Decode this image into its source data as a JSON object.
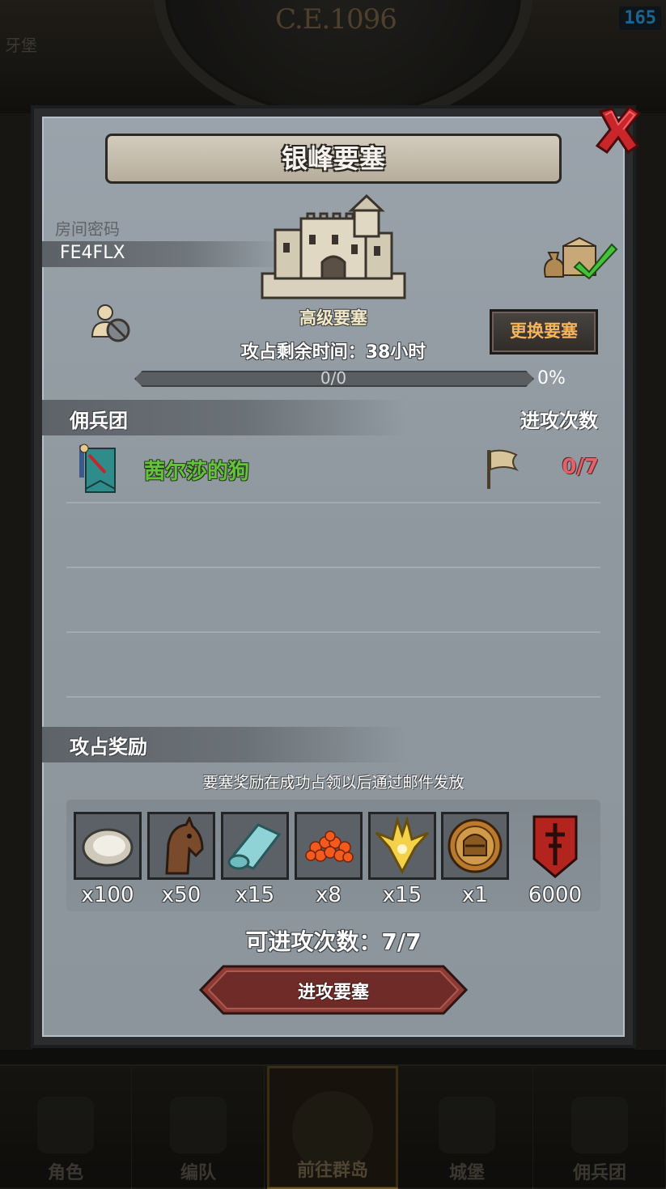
{
  "background": {
    "era_label": "C.E.1096",
    "fps": "165",
    "left_fragment": "牙堡"
  },
  "nav": {
    "items": [
      {
        "label": "角色",
        "icon": "character-icon"
      },
      {
        "label": "编队",
        "icon": "formation-icon"
      },
      {
        "label": "前往群岛",
        "icon": "archipelago-icon",
        "active": true
      },
      {
        "label": "城堡",
        "icon": "castle-icon"
      },
      {
        "label": "佣兵团",
        "icon": "mercenary-icon"
      }
    ]
  },
  "dialog": {
    "title": "银峰要塞",
    "room_label": "房间密码",
    "room_code": "FE4FLX",
    "fortress_level": "高级要塞",
    "change_button": "更换要塞",
    "remaining_time": "攻占剩余时间：38小时",
    "progress": {
      "count_text": "0/0",
      "percent_text": "0%",
      "fraction": 0
    },
    "mercenary_header": "佣兵团",
    "attacks_header": "进攻次数",
    "guilds": [
      {
        "name": "茜尔莎的狗",
        "attacks": "0/7"
      }
    ],
    "reward_header": "攻占奖励",
    "reward_note": "要塞奖励在成功占领以后通过邮件发放",
    "rewards": [
      {
        "icon": "oyster-icon",
        "qty": "x100"
      },
      {
        "icon": "horse-icon",
        "qty": "x50"
      },
      {
        "icon": "cloth-icon",
        "qty": "x15"
      },
      {
        "icon": "roe-icon",
        "qty": "x8"
      },
      {
        "icon": "gold-crest-icon",
        "qty": "x15"
      },
      {
        "icon": "helmet-medal-icon",
        "qty": "x1"
      },
      {
        "icon": "guild-banner-icon",
        "qty": "6000"
      }
    ],
    "attack_count": "可进攻次数：7/7",
    "attack_button": "进攻要塞"
  },
  "colors": {
    "guild_name": "#63c43c",
    "attack_zero": "#e0626b",
    "change_text": "#f5b55d",
    "fps": "#39b7ff"
  }
}
